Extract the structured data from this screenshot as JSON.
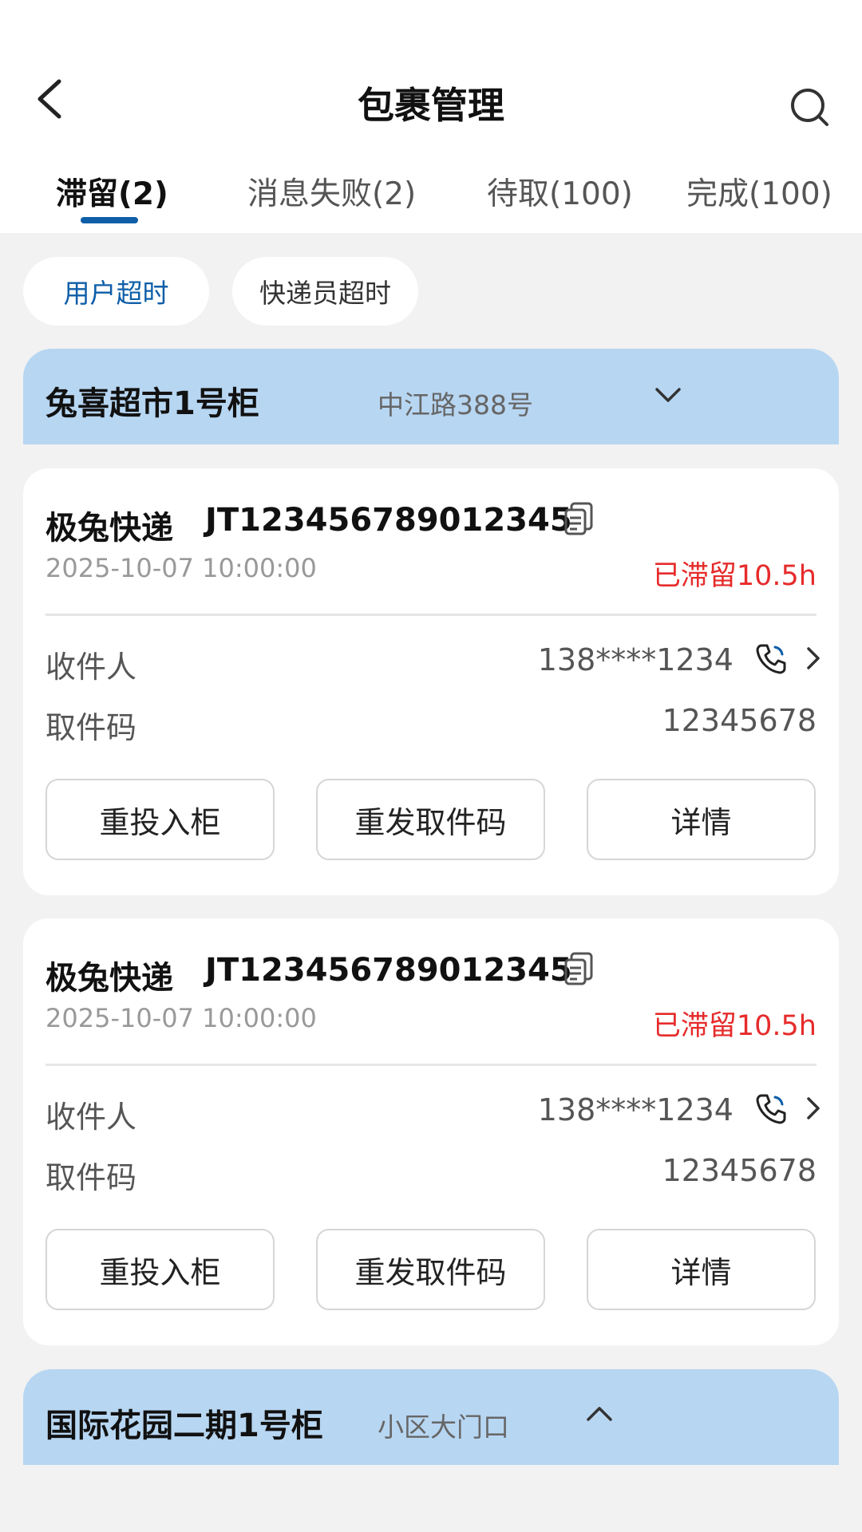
{
  "header": {
    "title": "包裹管理"
  },
  "tabs": [
    {
      "label": "滞留(2)",
      "active": true
    },
    {
      "label": "消息失败(2)",
      "active": false
    },
    {
      "label": "待取(100)",
      "active": false
    },
    {
      "label": "完成(100)",
      "active": false
    }
  ],
  "filters": [
    {
      "label": "用户超时",
      "active": true
    },
    {
      "label": "快递员超时",
      "active": false
    }
  ],
  "groups": [
    {
      "name": "兔喜超市1号柜",
      "address": "中江路388号",
      "expanded": true,
      "cards": [
        {
          "company": "极兔快递",
          "tracking": "JT123456789012345",
          "time": "2025-10-07   10:00:00",
          "stay": "已滞留10.5h",
          "recipient_label": "收件人",
          "recipient_phone": "138****1234",
          "code_label": "取件码",
          "code_value": "12345678",
          "actions": [
            "重投入柜",
            "重发取件码",
            "详情"
          ]
        },
        {
          "company": "极兔快递",
          "tracking": "JT123456789012345",
          "time": "2025-10-07   10:00:00",
          "stay": "已滞留10.5h",
          "recipient_label": "收件人",
          "recipient_phone": "138****1234",
          "code_label": "取件码",
          "code_value": "12345678",
          "actions": [
            "重投入柜",
            "重发取件码",
            "详情"
          ]
        }
      ]
    },
    {
      "name": "国际花园二期1号柜",
      "address": "小区大门口",
      "expanded": false
    }
  ],
  "colors": {
    "accent": "#0e5ea8",
    "group_header": "#b7d6f2",
    "warning": "#e62b2b",
    "background": "#f2f2f2"
  },
  "icons": [
    "back-arrow-icon",
    "search-icon",
    "chevron-down-icon",
    "copy-icon",
    "phone-icon",
    "chevron-right-icon",
    "chevron-up-icon"
  ]
}
